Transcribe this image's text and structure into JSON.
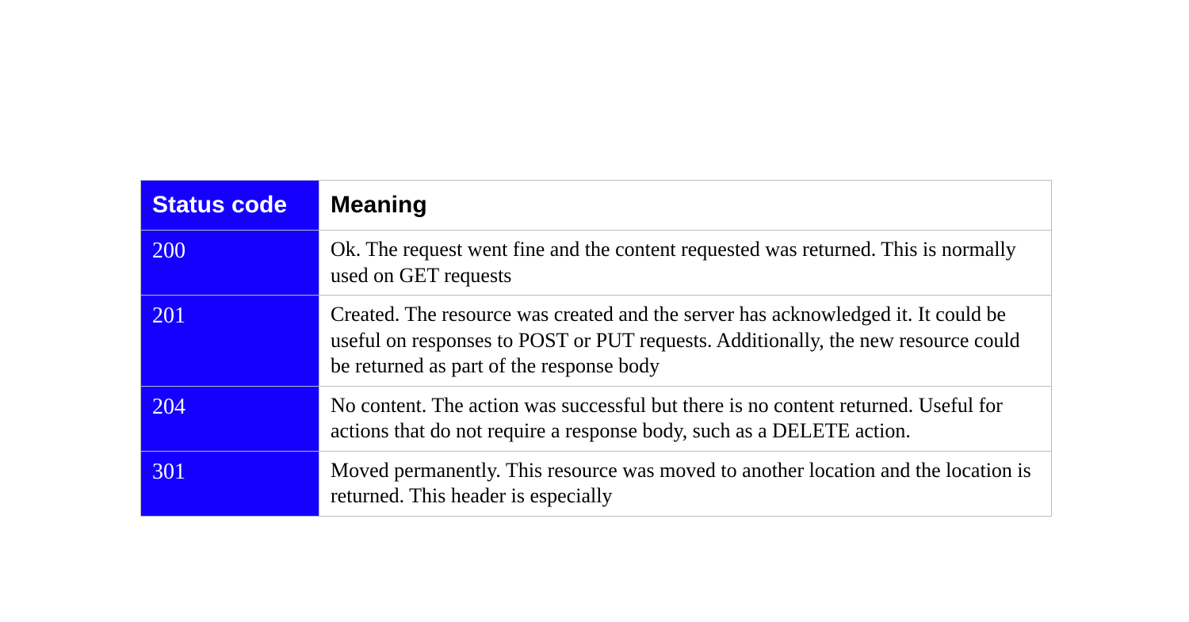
{
  "table": {
    "headers": {
      "code": "Status code",
      "meaning": "Meaning"
    },
    "rows": [
      {
        "code": "200",
        "meaning": "Ok. The request went fine and the content requested was returned. This is normally used on GET requests"
      },
      {
        "code": "201",
        "meaning": "Created. The resource was created and the server has acknowledged it. It could be useful on responses to POST or PUT requests. Additionally, the new resource could be returned as part of the response body"
      },
      {
        "code": "204",
        "meaning": "No content. The action was successful but there is no content returned. Useful for actions that do not require a response body, such as a DELETE action."
      },
      {
        "code": "301",
        "meaning": "Moved permanently. This resource was moved to another location and the location is returned. This header is especially"
      }
    ]
  }
}
